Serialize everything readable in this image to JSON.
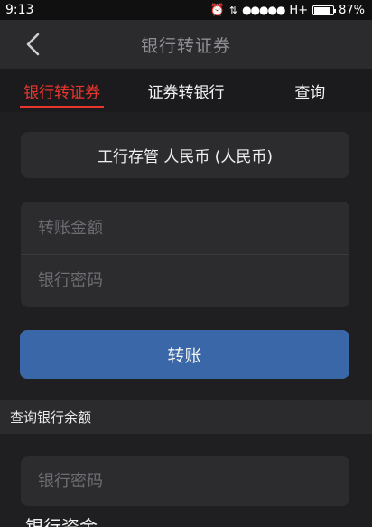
{
  "statusbar": {
    "time": "9:13",
    "alarm_icon": "alarm-clock-icon",
    "signal_dots": "●●●●●",
    "network": "H+",
    "battery_percent": "87%",
    "battery_level": 0.87
  },
  "navbar": {
    "back_icon": "chevron-left-icon",
    "title": "银行转证券"
  },
  "tabs": [
    {
      "label": "银行转证券",
      "active": true
    },
    {
      "label": "证券转银行",
      "active": false
    },
    {
      "label": "查询",
      "active": false
    }
  ],
  "account": {
    "label": "工行存管 人民币 (人民币)"
  },
  "form": {
    "amount_placeholder": "转账金额",
    "bank_password_placeholder": "银行密码",
    "submit_label": "转账"
  },
  "balance_section": {
    "header": "查询银行余额",
    "password_placeholder": "银行密码",
    "partial_label": "银行资金"
  },
  "colors": {
    "accent_red": "#e8352e",
    "button_blue": "#3a67a8",
    "background": "#1f1f21"
  }
}
